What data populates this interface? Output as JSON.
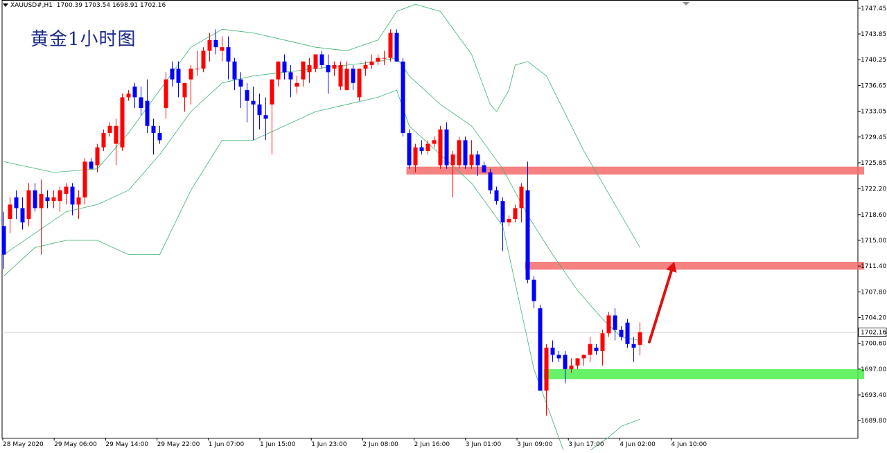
{
  "header": {
    "symbol": "XAUUSD#,H1",
    "ohlc": "1700.39 1703.54 1698.91 1702.16"
  },
  "overlay_title": "黄金1小时图",
  "chart_data": {
    "type": "candlestick",
    "title": "",
    "ylim": [
      1687.4,
      1748.6
    ],
    "y_ticks": [
      "1747.45",
      "1743.85",
      "1740.25",
      "1736.65",
      "1733.05",
      "1729.45",
      "1725.85",
      "1722.20",
      "1718.60",
      "1715.00",
      "1711.40",
      "1707.80",
      "1704.20",
      "1700.60",
      "1697.00",
      "1693.40",
      "1689.80"
    ],
    "x_ticks": [
      "28 May 2020",
      "29 May 06:00",
      "29 May 14:00",
      "29 May 22:00",
      "1 Jun 07:00",
      "1 Jun 15:00",
      "1 Jun 23:00",
      "2 Jun 08:00",
      "2 Jun 16:00",
      "3 Jun 01:00",
      "3 Jun 09:00",
      "3 Jun 17:00",
      "4 Jun 02:00",
      "4 Jun 10:00"
    ],
    "current_price": "1702.16",
    "colors": {
      "up": "#ff0000",
      "down": "#0000ff",
      "bands": "#3cb371",
      "resistance": "#f56b6b",
      "support": "#4cf04c",
      "arrow": "#e01010",
      "grid": "#c8c8c8"
    },
    "candles": [
      [
        1717.0,
        1719.0,
        1711.0,
        1713.0
      ],
      [
        1718.0,
        1721.0,
        1716.0,
        1720.0
      ],
      [
        1721.0,
        1722.0,
        1718.0,
        1719.5
      ],
      [
        1719.5,
        1721.0,
        1716.5,
        1717.5
      ],
      [
        1718.0,
        1723.0,
        1717.0,
        1722.0
      ],
      [
        1722.0,
        1723.0,
        1719.0,
        1719.5
      ],
      [
        1719.5,
        1723.5,
        1713.0,
        1721.5
      ],
      [
        1721.0,
        1722.0,
        1719.5,
        1720.5
      ],
      [
        1720.5,
        1722.0,
        1719.5,
        1721.0
      ],
      [
        1720.5,
        1722.5,
        1719.0,
        1722.0
      ],
      [
        1721.5,
        1723.0,
        1720.0,
        1722.5
      ],
      [
        1722.5,
        1723.0,
        1718.5,
        1720.0
      ],
      [
        1720.0,
        1722.0,
        1718.0,
        1721.0
      ],
      [
        1721.0,
        1726.5,
        1720.0,
        1726.0
      ],
      [
        1726.0,
        1726.5,
        1725.0,
        1725.0
      ],
      [
        1725.5,
        1728.5,
        1724.5,
        1728.0
      ],
      [
        1728.0,
        1730.5,
        1727.5,
        1730.0
      ],
      [
        1730.0,
        1731.5,
        1729.5,
        1731.0
      ],
      [
        1728.5,
        1732.0,
        1725.5,
        1731.0
      ],
      [
        1728.0,
        1735.5,
        1727.5,
        1735.0
      ],
      [
        1735.0,
        1736.0,
        1734.5,
        1735.5
      ],
      [
        1736.5,
        1737.0,
        1733.5,
        1735.0
      ],
      [
        1735.0,
        1736.5,
        1732.5,
        1733.5
      ],
      [
        1734.5,
        1737.5,
        1730.0,
        1731.0
      ],
      [
        1731.0,
        1732.0,
        1727.0,
        1730.0
      ],
      [
        1730.0,
        1731.0,
        1728.5,
        1729.0
      ],
      [
        1733.5,
        1738.5,
        1732.0,
        1737.5
      ],
      [
        1739.0,
        1740.0,
        1736.5,
        1737.5
      ],
      [
        1739.0,
        1740.0,
        1735.0,
        1737.0
      ],
      [
        1735.0,
        1737.0,
        1733.0,
        1737.0
      ],
      [
        1737.5,
        1739.5,
        1734.0,
        1739.0
      ],
      [
        1739.0,
        1741.5,
        1738.0,
        1739.0
      ],
      [
        1739.0,
        1742.0,
        1738.5,
        1741.5
      ],
      [
        1741.5,
        1744.0,
        1740.0,
        1743.0
      ],
      [
        1743.0,
        1744.5,
        1741.0,
        1742.0
      ],
      [
        1741.5,
        1743.5,
        1740.0,
        1742.0
      ],
      [
        1742.0,
        1743.5,
        1737.5,
        1740.0
      ],
      [
        1740.0,
        1740.5,
        1736.0,
        1737.5
      ],
      [
        1737.5,
        1738.5,
        1733.5,
        1736.5
      ],
      [
        1736.0,
        1737.0,
        1731.5,
        1734.5
      ],
      [
        1734.5,
        1736.5,
        1729.0,
        1734.0
      ],
      [
        1734.0,
        1735.5,
        1730.5,
        1732.5
      ],
      [
        1732.5,
        1735.0,
        1729.0,
        1732.0
      ],
      [
        1734.0,
        1737.5,
        1727.0,
        1737.5
      ],
      [
        1737.5,
        1740.0,
        1736.5,
        1740.0
      ],
      [
        1740.0,
        1741.0,
        1737.5,
        1738.5
      ],
      [
        1738.5,
        1739.5,
        1735.0,
        1737.5
      ],
      [
        1736.5,
        1738.0,
        1735.5,
        1737.0
      ],
      [
        1737.5,
        1740.0,
        1736.5,
        1740.0
      ],
      [
        1738.5,
        1740.5,
        1737.0,
        1739.5
      ],
      [
        1739.0,
        1741.0,
        1738.5,
        1741.0
      ],
      [
        1741.0,
        1741.5,
        1739.0,
        1739.5
      ],
      [
        1739.5,
        1741.0,
        1735.5,
        1738.5
      ],
      [
        1739.0,
        1740.0,
        1738.0,
        1739.5
      ],
      [
        1736.5,
        1740.0,
        1736.0,
        1739.5
      ],
      [
        1736.0,
        1740.0,
        1736.0,
        1739.0
      ],
      [
        1739.0,
        1739.5,
        1736.0,
        1737.0
      ],
      [
        1735.0,
        1739.0,
        1734.5,
        1739.0
      ],
      [
        1739.0,
        1740.0,
        1738.0,
        1739.5
      ],
      [
        1739.5,
        1741.0,
        1739.0,
        1740.0
      ],
      [
        1740.0,
        1741.0,
        1739.5,
        1740.5
      ],
      [
        1740.5,
        1741.5,
        1739.5,
        1740.5
      ],
      [
        1740.5,
        1744.5,
        1740.0,
        1744.0
      ],
      [
        1744.0,
        1744.5,
        1740.0,
        1740.0
      ],
      [
        1740.0,
        1740.5,
        1729.5,
        1730.0
      ],
      [
        1730.0,
        1730.5,
        1725.0,
        1725.5
      ],
      [
        1725.5,
        1728.5,
        1724.5,
        1728.0
      ],
      [
        1728.0,
        1729.0,
        1727.0,
        1727.5
      ],
      [
        1727.5,
        1729.0,
        1727.0,
        1728.5
      ],
      [
        1728.5,
        1729.5,
        1728.0,
        1729.0
      ],
      [
        1725.5,
        1731.0,
        1725.0,
        1730.5
      ],
      [
        1730.5,
        1731.5,
        1725.0,
        1725.5
      ],
      [
        1725.5,
        1727.5,
        1721.0,
        1727.0
      ],
      [
        1725.5,
        1729.5,
        1725.0,
        1729.0
      ],
      [
        1729.0,
        1729.5,
        1725.0,
        1725.5
      ],
      [
        1725.5,
        1729.0,
        1725.0,
        1727.0
      ],
      [
        1727.0,
        1727.5,
        1724.0,
        1725.5
      ],
      [
        1725.5,
        1726.0,
        1724.5,
        1724.5
      ],
      [
        1724.5,
        1725.0,
        1721.5,
        1722.0
      ],
      [
        1722.0,
        1722.5,
        1720.0,
        1720.5
      ],
      [
        1720.5,
        1721.0,
        1713.5,
        1717.5
      ],
      [
        1717.5,
        1718.5,
        1717.0,
        1718.0
      ],
      [
        1718.0,
        1720.0,
        1717.5,
        1719.5
      ],
      [
        1719.5,
        1723.0,
        1717.5,
        1722.5
      ],
      [
        1722.0,
        1726.0,
        1709.0,
        1709.5
      ],
      [
        1709.5,
        1710.0,
        1705.5,
        1706.5
      ],
      [
        1705.5,
        1706.0,
        1694.0,
        1694.0
      ],
      [
        1694.0,
        1700.5,
        1690.5,
        1700.0
      ],
      [
        1700.0,
        1701.0,
        1698.0,
        1699.0
      ],
      [
        1699.0,
        1699.5,
        1698.0,
        1698.5
      ],
      [
        1699.0,
        1699.5,
        1695.0,
        1697.0
      ],
      [
        1697.0,
        1698.5,
        1696.5,
        1697.5
      ],
      [
        1697.5,
        1698.5,
        1697.0,
        1698.5
      ],
      [
        1698.5,
        1699.0,
        1697.5,
        1699.0
      ],
      [
        1699.0,
        1701.5,
        1698.0,
        1700.5
      ],
      [
        1700.0,
        1700.5,
        1699.0,
        1699.5
      ],
      [
        1699.5,
        1702.5,
        1697.5,
        1702.0
      ],
      [
        1702.0,
        1705.0,
        1701.5,
        1704.5
      ],
      [
        1704.5,
        1705.5,
        1701.0,
        1702.5
      ],
      [
        1702.5,
        1703.0,
        1701.0,
        1701.5
      ],
      [
        1703.5,
        1704.0,
        1700.0,
        1700.5
      ],
      [
        1700.5,
        1701.5,
        1698.0,
        1700.0
      ],
      [
        1700.39,
        1703.54,
        1698.91,
        1702.16
      ]
    ],
    "bands": {
      "upper": [
        [
          0,
          1726
        ],
        [
          8,
          1724.5
        ],
        [
          15,
          1725
        ],
        [
          20,
          1730
        ],
        [
          25,
          1736
        ],
        [
          30,
          1742
        ],
        [
          35,
          1744.5
        ],
        [
          40,
          1744
        ],
        [
          45,
          1743
        ],
        [
          50,
          1742
        ],
        [
          55,
          1741.5
        ],
        [
          60,
          1743
        ],
        [
          63,
          1747
        ],
        [
          66,
          1748
        ],
        [
          70,
          1747
        ],
        [
          75,
          1741
        ],
        [
          78,
          1734
        ],
        [
          79,
          1733
        ],
        [
          81,
          1736
        ],
        [
          82,
          1739.5
        ],
        [
          84,
          1740
        ],
        [
          87,
          1738
        ],
        [
          93,
          1727.5
        ],
        [
          98,
          1720
        ],
        [
          102,
          1714
        ]
      ],
      "middle": [
        [
          0,
          1713
        ],
        [
          5,
          1716
        ],
        [
          10,
          1719
        ],
        [
          15,
          1720
        ],
        [
          20,
          1722
        ],
        [
          25,
          1727
        ],
        [
          30,
          1733
        ],
        [
          35,
          1737
        ],
        [
          40,
          1738
        ],
        [
          45,
          1738.5
        ],
        [
          50,
          1739
        ],
        [
          55,
          1739.5
        ],
        [
          60,
          1740
        ],
        [
          63,
          1740.5
        ],
        [
          65,
          1738
        ],
        [
          70,
          1734
        ],
        [
          75,
          1731
        ],
        [
          80,
          1725
        ],
        [
          84,
          1718.5
        ],
        [
          88,
          1713
        ],
        [
          92,
          1708
        ],
        [
          96,
          1704
        ],
        [
          99,
          1701.5
        ],
        [
          102,
          1701
        ]
      ],
      "lower": [
        [
          0,
          1710
        ],
        [
          5,
          1714
        ],
        [
          10,
          1715
        ],
        [
          15,
          1715
        ],
        [
          20,
          1713
        ],
        [
          25,
          1713
        ],
        [
          30,
          1722
        ],
        [
          35,
          1729
        ],
        [
          40,
          1729
        ],
        [
          45,
          1731
        ],
        [
          50,
          1733
        ],
        [
          55,
          1734
        ],
        [
          60,
          1735
        ],
        [
          63,
          1736
        ],
        [
          65,
          1731
        ],
        [
          70,
          1727
        ],
        [
          75,
          1723
        ],
        [
          80,
          1717
        ],
        [
          85,
          1697
        ],
        [
          90,
          1685
        ],
        [
          93,
          1685
        ],
        [
          97,
          1687.5
        ],
        [
          99,
          1689
        ],
        [
          102,
          1690
        ]
      ]
    },
    "zones": [
      {
        "kind": "resistance",
        "from": 1725.3,
        "to": 1724.2,
        "start": 65
      },
      {
        "kind": "resistance",
        "from": 1712.0,
        "to": 1710.9,
        "start": 84
      },
      {
        "kind": "support",
        "from": 1697.0,
        "to": 1695.6,
        "start": 87
      }
    ],
    "arrow": {
      "from": [
        103.5,
        1700.8
      ],
      "to": [
        107.5,
        1712.0
      ]
    }
  }
}
